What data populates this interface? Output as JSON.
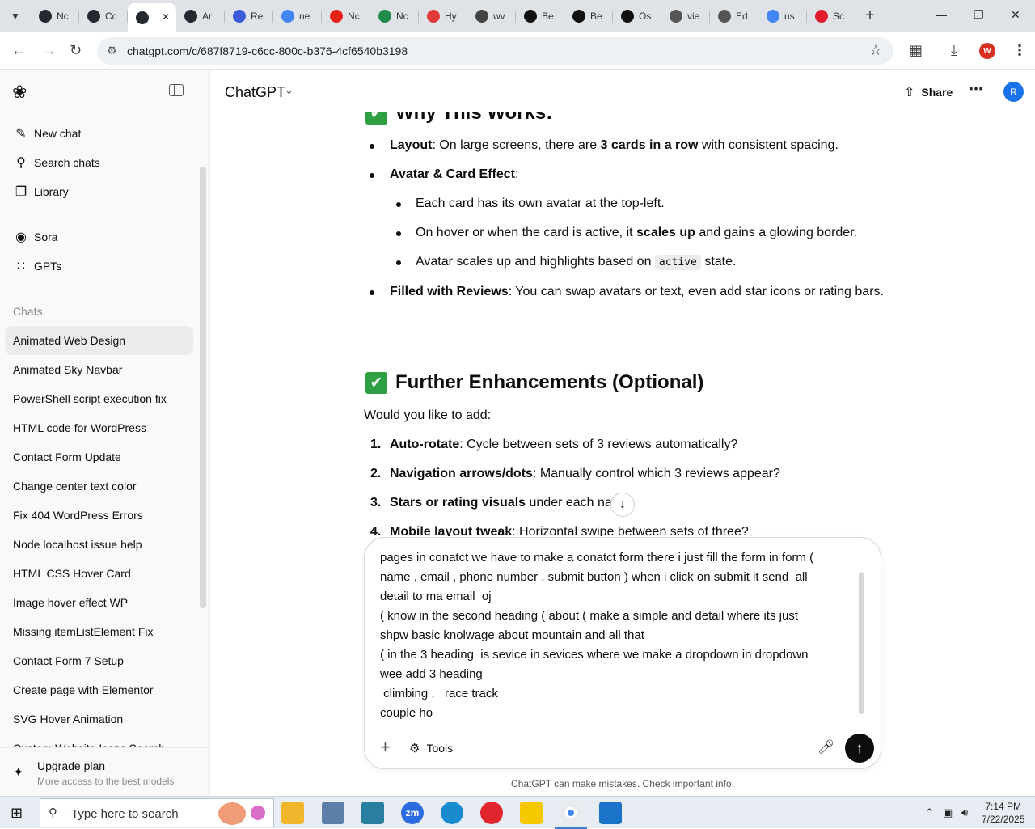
{
  "browser": {
    "tabs": [
      {
        "label": "Nc",
        "icon": "github-icon",
        "color": "#24292f"
      },
      {
        "label": "Cc",
        "icon": "chatgpt-icon",
        "color": "#24292f"
      },
      {
        "label": "",
        "icon": "chatgpt-icon",
        "color": "#24292f",
        "active": true
      },
      {
        "label": "Ar",
        "icon": "chatgpt-icon",
        "color": "#24292f"
      },
      {
        "label": "Re",
        "icon": "react-icon",
        "color": "#3b5bdb"
      },
      {
        "label": "ne",
        "icon": "google-icon",
        "color": "#4285f4"
      },
      {
        "label": "Nc",
        "icon": "youtube-icon",
        "color": "#e62117"
      },
      {
        "label": "Nc",
        "icon": "wordpress-icon",
        "color": "#1e8a4c"
      },
      {
        "label": "Hy",
        "icon": "hy-icon",
        "color": "#e23a3a"
      },
      {
        "label": "wv",
        "icon": "linkedin-icon",
        "color": "#444"
      },
      {
        "label": "Be",
        "icon": "x-icon",
        "color": "#111"
      },
      {
        "label": "Be",
        "icon": "x-icon",
        "color": "#111"
      },
      {
        "label": "Os",
        "icon": "os-icon",
        "color": "#111"
      },
      {
        "label": "vie",
        "icon": "edge-icon",
        "color": "#555"
      },
      {
        "label": "Ed",
        "icon": "edge-icon",
        "color": "#555"
      },
      {
        "label": "us",
        "icon": "google-icon",
        "color": "#4285f4"
      },
      {
        "label": "Sc",
        "icon": "adobe-icon",
        "color": "#e01e2a"
      }
    ],
    "url": "chatgpt.com/c/687f8719-c6cc-800c-b376-4cf6540b3198",
    "profile_letter": "W"
  },
  "sidebar": {
    "top_items": [
      {
        "label": "New chat",
        "icon": "edit-icon"
      },
      {
        "label": "Search chats",
        "icon": "search-icon"
      },
      {
        "label": "Library",
        "icon": "library-icon"
      }
    ],
    "apps": [
      {
        "label": "Sora",
        "icon": "sora-icon"
      },
      {
        "label": "GPTs",
        "icon": "gpts-icon"
      }
    ],
    "chats_label": "Chats",
    "chats": [
      "Animated Web Design",
      "Animated Sky Navbar",
      "PowerShell script execution fix",
      "HTML code for WordPress",
      "Contact Form Update",
      "Change center text color",
      "Fix 404 WordPress Errors",
      "Node localhost issue help",
      "HTML CSS Hover Card",
      "Image hover effect WP",
      "Missing itemListElement Fix",
      "Contact Form 7 Setup",
      "Create page with Elementor",
      "SVG Hover Animation",
      "Custom Website Icons Search"
    ],
    "upgrade_title": "Upgrade plan",
    "upgrade_subtitle": "More access to the best models"
  },
  "header": {
    "model": "ChatGPT",
    "share_label": "Share",
    "avatar_letter": "R"
  },
  "content": {
    "why_heading": "Why This Works:",
    "why_items": {
      "layout_b": "Layout",
      "layout_t1": ": On large screens, there are ",
      "layout_b2": "3 cards in a row",
      "layout_t2": " with consistent spacing.",
      "avatar_b": "Avatar & Card Effect",
      "avatar_t": ":",
      "sub1": "Each card has its own avatar at the top-left.",
      "sub2_t1": "On hover or when the card is active, it ",
      "sub2_b": "scales up",
      "sub2_t2": " and gains a glowing border.",
      "sub3_t1": "Avatar scales up and highlights based on ",
      "sub3_code": "active",
      "sub3_t2": " state.",
      "filled_b": "Filled with Reviews",
      "filled_t": ": You can swap avatars or text, even add star icons or rating bars."
    },
    "further_heading": "Further Enhancements (Optional)",
    "further_intro": "Would you like to add:",
    "further_items": [
      {
        "num": "1.",
        "b": "Auto-rotate",
        "t": ": Cycle between sets of 3 reviews automatically?"
      },
      {
        "num": "2.",
        "b": "Navigation arrows/dots",
        "t": ": Manually control which 3 reviews appear?"
      },
      {
        "num": "3.",
        "b": "Stars or rating visuals",
        "t": " under each nam"
      },
      {
        "num": "4.",
        "b": "Mobile layout tweak",
        "t": ": Horizontal swipe between sets of three?"
      }
    ]
  },
  "composer": {
    "lines": [
      "pages in conatct we have to make a conatct form there i just fill the form in form (",
      "name , email , phone number , submit button ) when i click on submit it send  all",
      "detail to ma email  oj",
      "( know in the second heading ( about ( make a simple and detail where its just",
      "shpw basic knolwage about mountain and all that",
      "( in the 3 heading  is sevice in sevices where we make a dropdown in dropdown",
      "wee add 3 heading",
      " climbing ,   race track",
      "couple ho"
    ],
    "tools_label": "Tools",
    "disclaimer": "ChatGPT can make mistakes. Check important info."
  },
  "taskbar": {
    "search_placeholder": "Type here to search",
    "time": "7:14 PM",
    "date": "7/22/2025"
  }
}
